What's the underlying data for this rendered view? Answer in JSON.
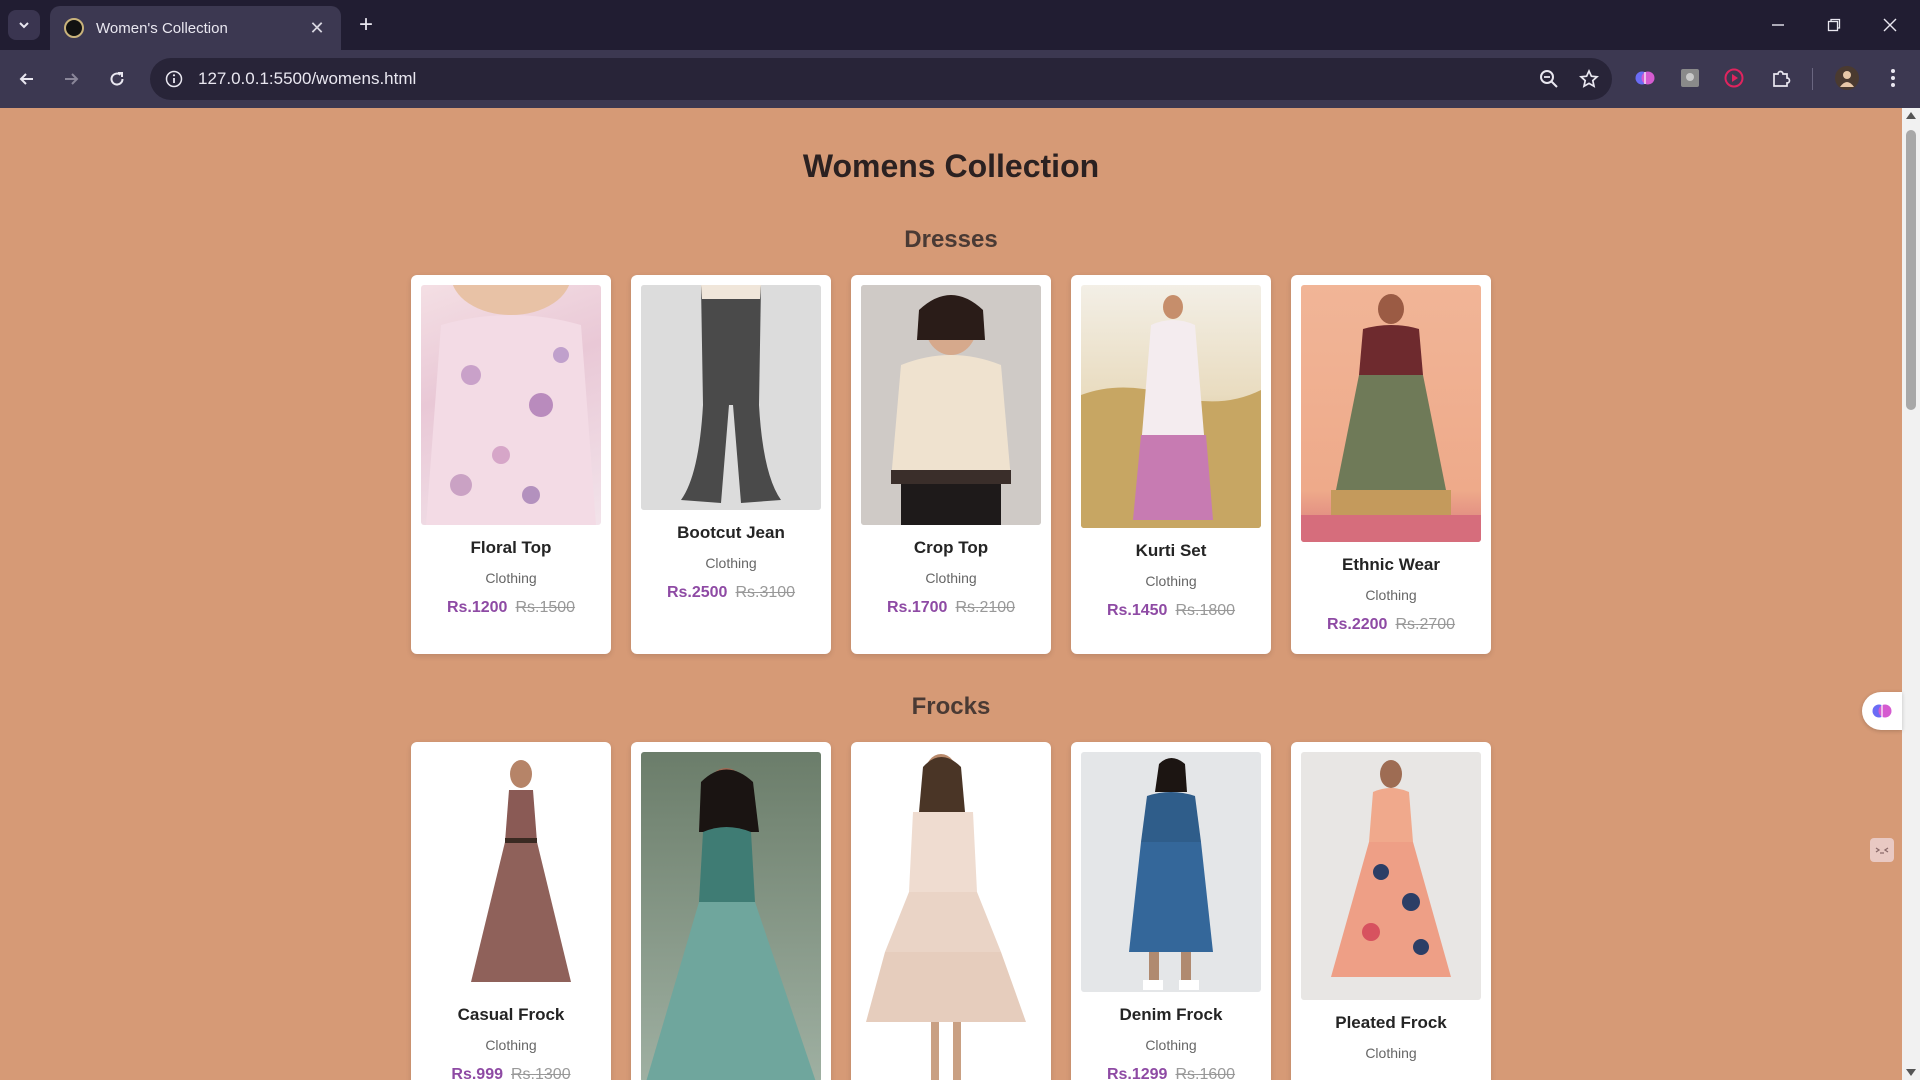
{
  "browser": {
    "tab_title": "Women's Collection",
    "url": "127.0.0.1:5500/womens.html",
    "tab_close": "✕",
    "new_tab": "+"
  },
  "page": {
    "title": "Womens Collection",
    "sections": [
      {
        "title": "Dresses",
        "products": [
          {
            "name": "Floral Top",
            "category": "Clothing",
            "price": "Rs.1200",
            "old_price": "Rs.1500"
          },
          {
            "name": "Bootcut Jean",
            "category": "Clothing",
            "price": "Rs.2500",
            "old_price": "Rs.3100"
          },
          {
            "name": "Crop Top",
            "category": "Clothing",
            "price": "Rs.1700",
            "old_price": "Rs.2100"
          },
          {
            "name": "Kurti Set",
            "category": "Clothing",
            "price": "Rs.1450",
            "old_price": "Rs.1800"
          },
          {
            "name": "Ethnic Wear",
            "category": "Clothing",
            "price": "Rs.2200",
            "old_price": "Rs.2700"
          }
        ]
      },
      {
        "title": "Frocks",
        "products": [
          {
            "name": "Casual Frock",
            "category": "Clothing",
            "price": "Rs.999",
            "old_price": "Rs.1300"
          },
          {
            "name": "",
            "category": "",
            "price": "",
            "old_price": ""
          },
          {
            "name": "",
            "category": "",
            "price": "",
            "old_price": ""
          },
          {
            "name": "Denim Frock",
            "category": "Clothing",
            "price": "Rs.1299",
            "old_price": "Rs.1600"
          },
          {
            "name": "Pleated Frock",
            "category": "Clothing",
            "price": "",
            "old_price": ""
          }
        ]
      }
    ]
  },
  "colors": {
    "page_background": "#d69a76",
    "price_accent": "#8e4aa4",
    "browser_frame": "#211d32",
    "browser_toolbar": "#3c3851"
  }
}
